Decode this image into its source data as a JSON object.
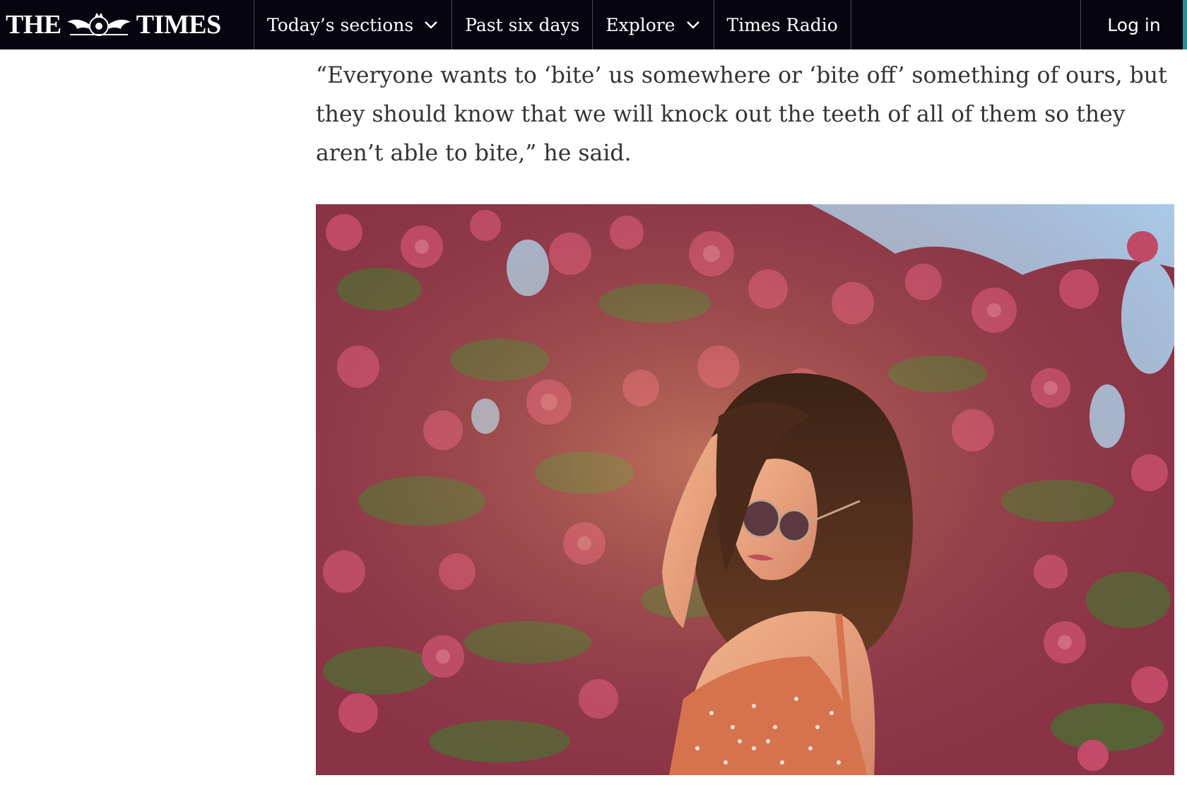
{
  "header": {
    "logo_left": "THE",
    "logo_right": "TIMES",
    "nav": [
      {
        "label": "Today’s sections",
        "has_dropdown": true
      },
      {
        "label": "Past six days",
        "has_dropdown": false
      },
      {
        "label": "Explore",
        "has_dropdown": true
      },
      {
        "label": "Times Radio",
        "has_dropdown": false
      }
    ],
    "login_label": "Log in",
    "background": "#05040f"
  },
  "article": {
    "quote": "“Everyone wants to ‘bite’ us somewhere or ‘bite off’ something of ours, but they should know that we will knock out the teeth of all of them so they aren’t able to bite,” he said."
  },
  "colors": {
    "text": "#333333",
    "blossom": "#c44a6a",
    "sky": "#a9c9e6",
    "leaf": "#4d6b34"
  }
}
